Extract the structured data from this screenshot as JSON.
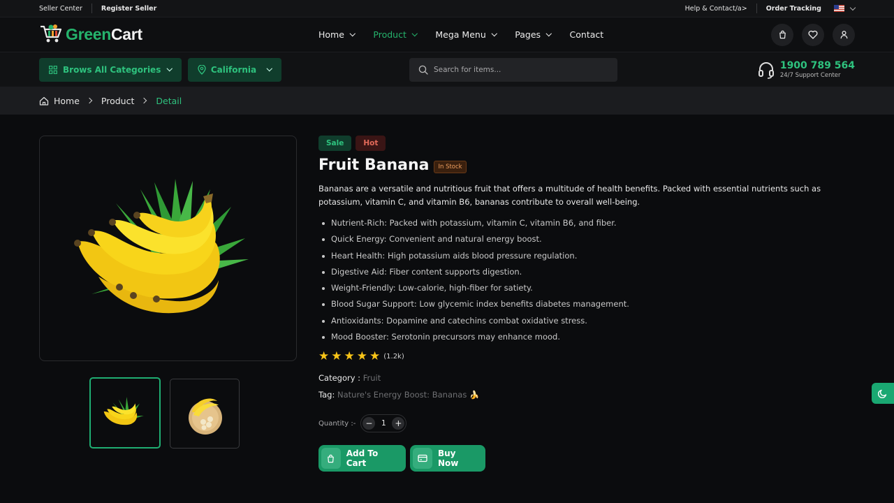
{
  "topbar": {
    "seller_center": "Seller Center",
    "register_seller": "Register Seller",
    "help_contact": "Help & Contact/a>",
    "order_tracking": "Order Tracking",
    "language_flag": "us-flag"
  },
  "brand": {
    "logo_green": "Green",
    "logo_rest": "Cart",
    "accent_color": "#25b36c"
  },
  "nav": {
    "items": [
      {
        "label": "Home",
        "has_dropdown": true,
        "active": false
      },
      {
        "label": "Product",
        "has_dropdown": true,
        "active": true
      },
      {
        "label": "Mega Menu",
        "has_dropdown": true,
        "active": false
      },
      {
        "label": "Pages",
        "has_dropdown": true,
        "active": false
      },
      {
        "label": "Contact",
        "has_dropdown": false,
        "active": false
      }
    ],
    "icons": [
      "bag-icon",
      "heart-icon",
      "user-icon"
    ]
  },
  "subbar": {
    "categories_label": "Brows All Categories",
    "location_label": "California",
    "search_placeholder": "Search for items...",
    "support_number": "1900 789 564",
    "support_label": "24/7 Support Center"
  },
  "breadcrumb": {
    "items": [
      "Home",
      "Product",
      "Detail"
    ]
  },
  "product": {
    "badges": [
      "Sale",
      "Hot"
    ],
    "title": "Fruit Banana",
    "stock_status": "In Stock",
    "description": "Bananas are a versatile and nutritious fruit that offers a multitude of health benefits. Packed with essential nutrients such as potassium, vitamin C, and vitamin B6, bananas contribute to overall well-being.",
    "features": [
      "Nutrient-Rich: Packed with potassium, vitamin C, vitamin B6, and fiber.",
      "Quick Energy: Convenient and natural energy boost.",
      "Heart Health: High potassium aids blood pressure regulation.",
      "Digestive Aid: Fiber content supports digestion.",
      "Weight-Friendly: Low-calorie, high-fiber for satiety.",
      "Blood Sugar Support: Low glycemic index benefits diabetes management.",
      "Antioxidants: Dopamine and catechins combat oxidative stress.",
      "Mood Booster: Serotonin precursors may enhance mood."
    ],
    "rating_stars": 5,
    "rating_count": "(1.2k)",
    "category_label": "Category :",
    "category_value": "Fruit",
    "tag_label": "Tag:",
    "tag_value": "Nature's Energy Boost: Bananas 🍌",
    "quantity_label": "Quantity :-",
    "quantity_value": "1",
    "add_to_cart_label": "Add To Cart",
    "buy_now_label": "Buy Now"
  },
  "gallery": {
    "thumbnails": [
      "banana-bunch",
      "banana-plate"
    ],
    "selected_index": 0
  }
}
